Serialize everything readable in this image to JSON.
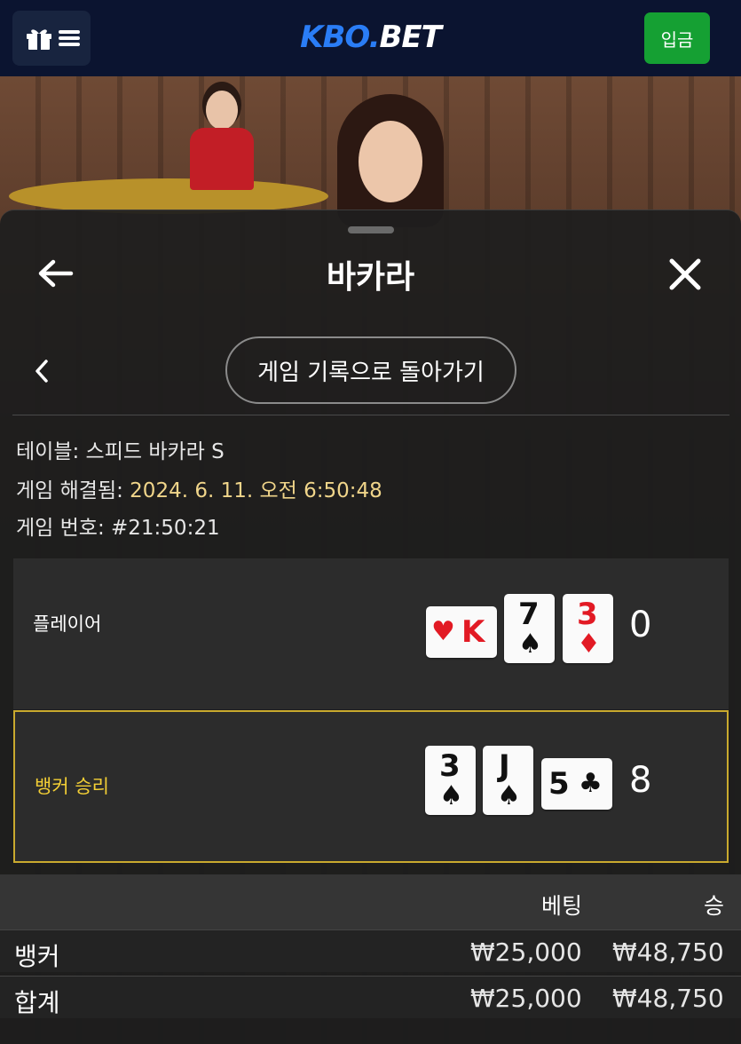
{
  "header": {
    "logo_kbo": "KBO",
    "logo_dot": ".",
    "logo_bet": "BET",
    "deposit_label": "입금",
    "icons": [
      "gift-icon",
      "hamburger-menu-icon"
    ],
    "bg_color": "#0b1430",
    "deposit_color": "#15a033"
  },
  "sheet": {
    "title": "바카라",
    "back_to_history_label": "게임 기록으로 돌아가기",
    "icons": [
      "back-arrow-icon",
      "close-icon",
      "chevron-left-icon"
    ]
  },
  "info": {
    "table_label": "테이블: ",
    "table_value": "스피드 바카라 S",
    "resolved_label": "게임 해결됨: ",
    "resolved_value": "2024. 6. 11. 오전 6:50:48",
    "round_label": "게임 번호: ",
    "round_value": "#21:50:21"
  },
  "results": {
    "player": {
      "label": "플레이어",
      "score": "0",
      "cards": [
        {
          "rank": "K",
          "suit": "♥",
          "color": "red",
          "orientation": "horizontal"
        },
        {
          "rank": "7",
          "suit": "♠",
          "color": "black",
          "orientation": "vertical"
        },
        {
          "rank": "3",
          "suit": "♦",
          "color": "red",
          "orientation": "vertical"
        }
      ]
    },
    "banker": {
      "label": "뱅커 승리",
      "score": "8",
      "cards": [
        {
          "rank": "3",
          "suit": "♠",
          "color": "black",
          "orientation": "vertical"
        },
        {
          "rank": "J",
          "suit": "♠",
          "color": "black",
          "orientation": "vertical"
        },
        {
          "rank": "5",
          "suit": "♣",
          "color": "black",
          "orientation": "horizontal"
        }
      ],
      "highlight_color": "#c9aa2e"
    }
  },
  "bets": {
    "col_bet": "베팅",
    "col_win": "승",
    "rows": [
      {
        "name": "뱅커",
        "bet": "₩25,000",
        "win": "₩48,750"
      },
      {
        "name": "합계",
        "bet": "₩25,000",
        "win": "₩48,750"
      }
    ]
  }
}
